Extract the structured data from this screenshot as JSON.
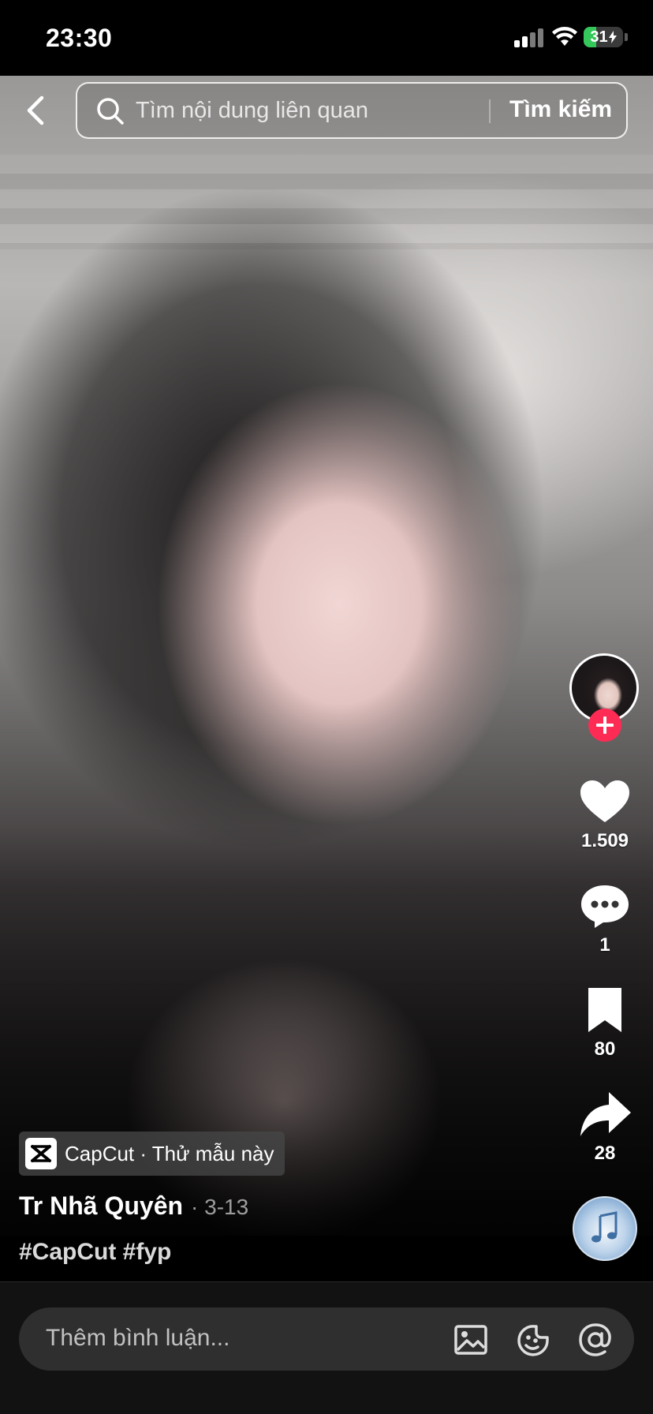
{
  "status_bar": {
    "time": "23:30",
    "battery_level": "31",
    "battery_percent_value": 31,
    "battery_charging": true
  },
  "search": {
    "placeholder": "Tìm nội dung liên quan",
    "submit_label": "Tìm kiếm"
  },
  "actions": {
    "likes": "1.509",
    "comments": "1",
    "bookmarks": "80",
    "shares": "28"
  },
  "template": {
    "label": "CapCut · Thử mẫu này"
  },
  "post": {
    "author": "Tr Nhã Quyên",
    "date": "· 3-13",
    "caption": "#CapCut #fyp"
  },
  "comment": {
    "placeholder": "Thêm bình luận..."
  },
  "colors": {
    "accent": "#fe2c55",
    "battery": "#34c759",
    "comment_bg": "#2f2f2f"
  },
  "icons": {
    "back": "chevron-left-icon",
    "search": "search-icon",
    "like": "heart-icon",
    "comment": "comment-bubble-icon",
    "bookmark": "bookmark-icon",
    "share": "share-arrow-icon",
    "music": "music-note-icon",
    "image": "image-icon",
    "emoji": "emoji-icon",
    "mention": "at-icon"
  }
}
